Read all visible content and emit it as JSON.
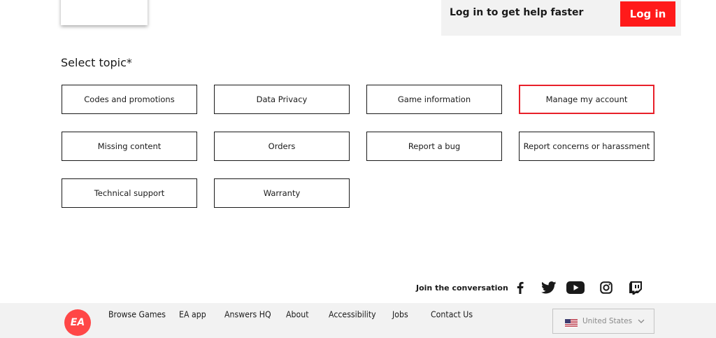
{
  "login": {
    "prompt": "Log in to get help faster",
    "button_label": "Log in"
  },
  "topics": {
    "title": "Select topic*",
    "items": [
      {
        "label": "Codes and promotions",
        "selected": false
      },
      {
        "label": "Data Privacy",
        "selected": false
      },
      {
        "label": "Game information",
        "selected": false
      },
      {
        "label": "Manage my account",
        "selected": true
      },
      {
        "label": "Missing content",
        "selected": false
      },
      {
        "label": "Orders",
        "selected": false
      },
      {
        "label": "Report a bug",
        "selected": false
      },
      {
        "label": "Report concerns or harassment",
        "selected": false
      },
      {
        "label": "Technical support",
        "selected": false
      },
      {
        "label": "Warranty",
        "selected": false
      }
    ]
  },
  "social": {
    "label": "Join the conversation",
    "icons": [
      "facebook-icon",
      "twitter-icon",
      "youtube-icon",
      "instagram-icon",
      "twitch-icon"
    ]
  },
  "footer": {
    "logo_text": "EA",
    "links": [
      "Browse Games",
      "EA app",
      "Answers HQ",
      "About",
      "Accessibility",
      "Jobs",
      "Contact Us"
    ],
    "region": "United States"
  },
  "colors": {
    "brand_red": "#ff1a1a",
    "selected_border": "#e8202a",
    "ea_logo": "#ff4747",
    "footer_bg": "#f2f2f2"
  }
}
